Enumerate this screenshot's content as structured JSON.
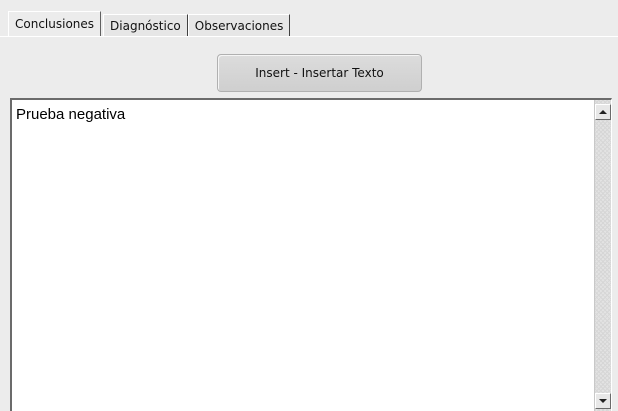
{
  "tabs": [
    {
      "label": "Conclusiones",
      "active": true
    },
    {
      "label": "Diagnóstico",
      "active": false
    },
    {
      "label": "Observaciones",
      "active": false
    }
  ],
  "toolbar": {
    "insert_label": "Insert - Insertar Texto"
  },
  "editor": {
    "text": "Prueba negativa"
  },
  "scrollbar": {
    "up_icon": "arrow-up-icon",
    "down_icon": "arrow-down-icon"
  },
  "colors": {
    "panel_bg": "#ececec",
    "editor_bg": "#ffffff",
    "button_bg": "#d6d6d6"
  }
}
